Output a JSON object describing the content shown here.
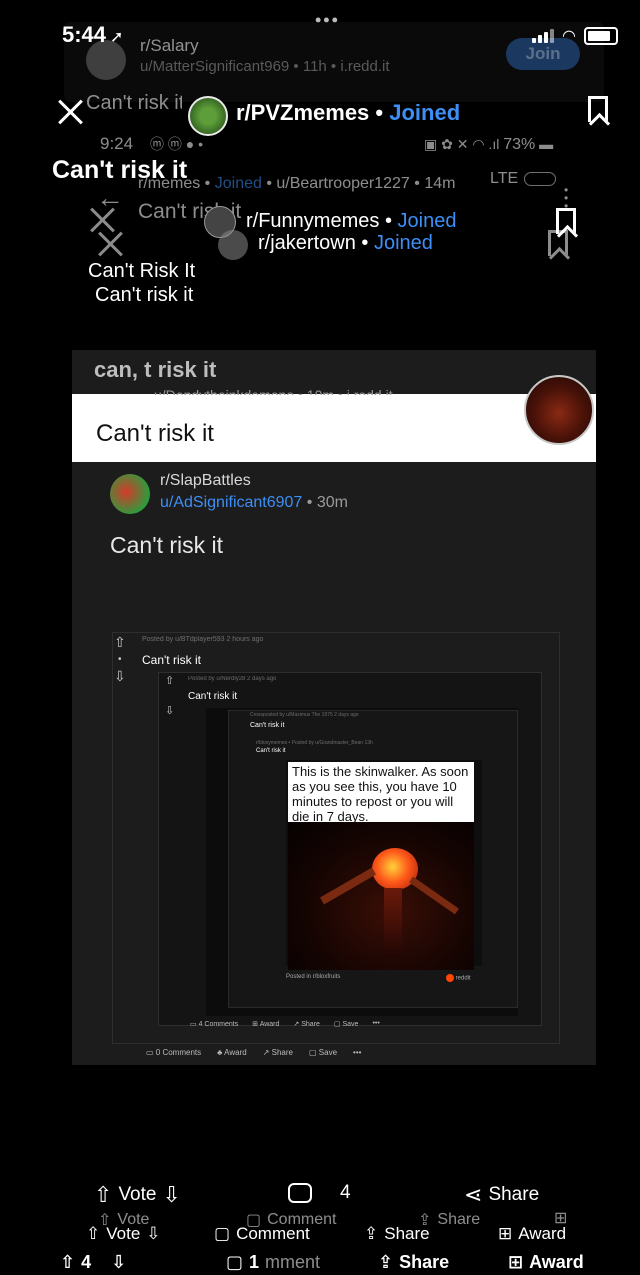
{
  "status": {
    "time": "5:44"
  },
  "bg_header": {
    "subreddit": "r/Salary",
    "meta": "u/MatterSignificant969 • 11h • i.redd.it",
    "join": "Join"
  },
  "layer1": {
    "title_partial": "Can't risk it",
    "subreddit": "r/PVZmemes",
    "sep": "•",
    "joined": "Joined"
  },
  "layer2": {
    "time": "9:24",
    "battery": "73%",
    "heading": "Can't risk it",
    "meta_sub": "r/memes",
    "joined": "Joined",
    "meta_user": "• u/Beartrooper1227 • 14m",
    "lte": "LTE",
    "title": "Can't risk it"
  },
  "layer3": {
    "subreddit_a": "r/Funnymemes",
    "subreddit_b": "r/jakertown",
    "sep": "•",
    "joined": "Joined",
    "caption_a": "Can't Risk It",
    "caption_b": "Can't risk it"
  },
  "card": {
    "header": "can, t risk it",
    "cut_meta": "u/Dendytheinkdemono • 10m • i.redd.it",
    "white_title": "Can't risk it",
    "subreddit": "r/SlapBattles",
    "user": "u/AdSignificant6907",
    "age": "• 30m",
    "title": "Can't risk it"
  },
  "nested": {
    "n1_meta": "Posted by u/BTdplayer593 2 hours ago",
    "n1_title": "Can't risk it",
    "n2_meta": "Posted by u/Nerdly28 2 days ago",
    "n2_title": "Can't risk it",
    "n3_meta": "Crossposted by u/Maximus The 1975 2 days ago",
    "n3_title": "Can't risk it",
    "n4_meta": "r/bloxymemes • Posted by u/Grandmaster_Bean 13h",
    "n4_title": "Can't risk it",
    "skin_text": "This is the skinwalker. As soon as you see this, you have 10 minutes to repost or you will die in 7 days.",
    "posted_in": "Posted in r/bloxfruits",
    "reddit_tag": "reddit",
    "n2_comments": "4 Comments",
    "n2_award": "Award",
    "n2_share": "Share",
    "n2_save": "Save",
    "n1_comments": "0 Comments",
    "n1_award": "Award",
    "n1_share": "Share",
    "n1_save": "Save",
    "more": "•••"
  },
  "bottom": {
    "row1": {
      "vote": "Vote",
      "comment_count": "4",
      "share": "Share"
    },
    "row1_ghost": {
      "vote": "Vote",
      "comment": "Comment",
      "share": "Share"
    },
    "row2": {
      "vote": "Vote",
      "comment": "Comment",
      "share": "Share",
      "award": "Award"
    },
    "row3": {
      "count": "4",
      "comment_count": "1",
      "comment_ghost": "mment",
      "share": "Share",
      "award": "Award"
    }
  }
}
